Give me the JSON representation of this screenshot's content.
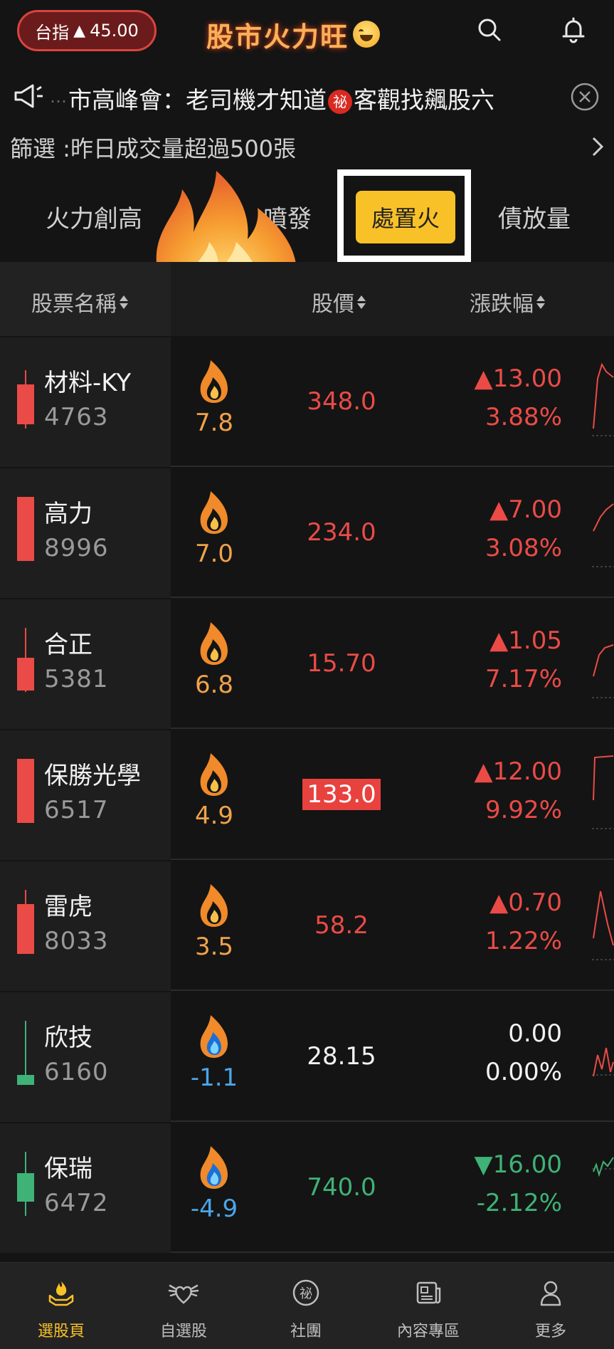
{
  "header": {
    "index_label": "台指",
    "index_arrow": "▲",
    "index_value": "45.00",
    "app_title": "股市火力旺"
  },
  "ticker": {
    "fade_char": "…",
    "text_a": "市高峰會：老司機才知道",
    "secret_badge": "祕",
    "text_b": "客觀找飆股六"
  },
  "filter": {
    "label": "篩選 :昨日成交量超過500張"
  },
  "tabs": [
    {
      "label": "火力創高"
    },
    {
      "label": "噴發"
    },
    {
      "label": "處置火",
      "active": true
    },
    {
      "label": "債放量"
    }
  ],
  "columns": {
    "name": "股票名稱",
    "price": "股價",
    "change": "漲跌幅"
  },
  "colors": {
    "up": "#ea4b47",
    "down": "#3fb277",
    "accent": "#f9c128"
  },
  "stocks": [
    {
      "name": "材料-KY",
      "code": "4763",
      "score": "7.8",
      "price": "348.0",
      "change": "▲13.00",
      "pct": "3.88%",
      "dir": "up",
      "flame": "fire-icon"
    },
    {
      "name": "高力",
      "code": "8996",
      "score": "7.0",
      "price": "234.0",
      "change": "▲7.00",
      "pct": "3.08%",
      "dir": "up",
      "flame": "fire-icon"
    },
    {
      "name": "合正",
      "code": "5381",
      "score": "6.8",
      "price": "15.70",
      "change": "▲1.05",
      "pct": "7.17%",
      "dir": "up",
      "flame": "fire-icon"
    },
    {
      "name": "保勝光學",
      "code": "6517",
      "score": "4.9",
      "price": "133.0",
      "change": "▲12.00",
      "pct": "9.92%",
      "dir": "up",
      "flame": "fire-icon",
      "limit_up": true
    },
    {
      "name": "雷虎",
      "code": "8033",
      "score": "3.5",
      "price": "58.2",
      "change": "▲0.70",
      "pct": "1.22%",
      "dir": "up",
      "flame": "fire-icon"
    },
    {
      "name": "欣技",
      "code": "6160",
      "score": "-1.1",
      "price": "28.15",
      "change": "0.00",
      "pct": "0.00%",
      "dir": "flat",
      "flame": "blue-fire-icon"
    },
    {
      "name": "保瑞",
      "code": "6472",
      "score": "-4.9",
      "price": "740.0",
      "change": "▼16.00",
      "pct": "-2.12%",
      "dir": "down",
      "flame": "blue-fire-icon"
    }
  ],
  "bottom_nav": [
    {
      "label": "選股頁",
      "icon": "hand-fire-icon",
      "active": true
    },
    {
      "label": "自選股",
      "icon": "winged-heart-icon"
    },
    {
      "label": "社團",
      "icon": "secret-circle-icon"
    },
    {
      "label": "內容專區",
      "icon": "newspaper-icon"
    },
    {
      "label": "更多",
      "icon": "person-icon"
    }
  ]
}
